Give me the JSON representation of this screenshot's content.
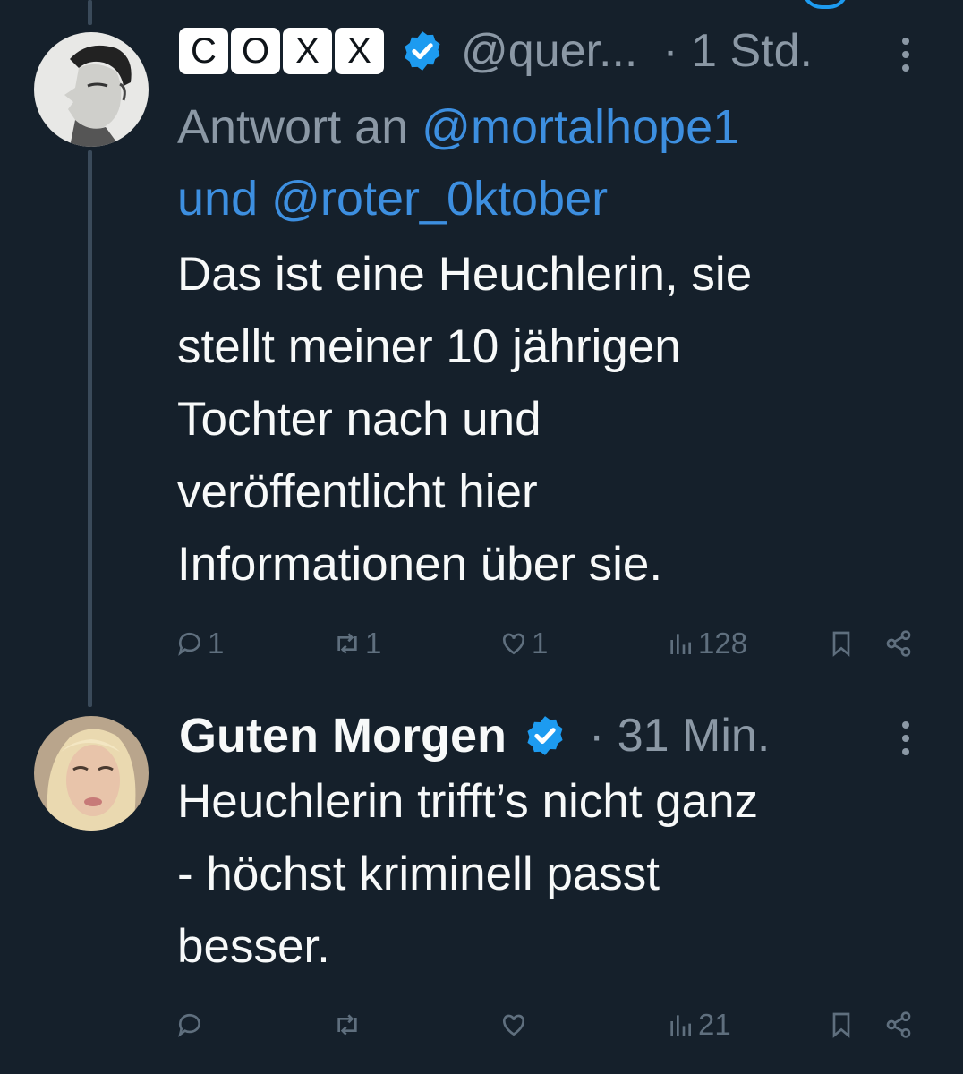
{
  "colors": {
    "background": "#15202b",
    "text": "#f7f9f9",
    "muted": "#8b98a5",
    "mention": "#3d8fe0",
    "verified": "#1d9bf0"
  },
  "tweets": [
    {
      "name_boxes": [
        "C",
        "O",
        "X",
        "X"
      ],
      "handle": "@quer...",
      "time": "· 1 Std.",
      "reply_prefix": "Antwort an ",
      "mention_1": "@mortalhope1",
      "reply_join": "und ",
      "mention_2": "@roter_0ktober",
      "text": "Das ist eine Heuchlerin, sie\nstellt meiner 10 jährigen\nTochter nach und\nveröffentlicht hier\nInformationen über sie.",
      "stats": {
        "replies": "1",
        "retweets": "1",
        "likes": "1",
        "views": "128"
      }
    },
    {
      "name": "Guten Morgen",
      "time": "· 31 Min.",
      "text": "Heuchlerin trifft’s nicht ganz\n- höchst kriminell passt\nbesser.",
      "stats": {
        "views": "21"
      }
    }
  ],
  "icons": [
    "verified-badge-icon",
    "more-icon",
    "reply-icon",
    "retweet-icon",
    "like-icon",
    "views-icon",
    "bookmark-icon",
    "share-icon"
  ]
}
